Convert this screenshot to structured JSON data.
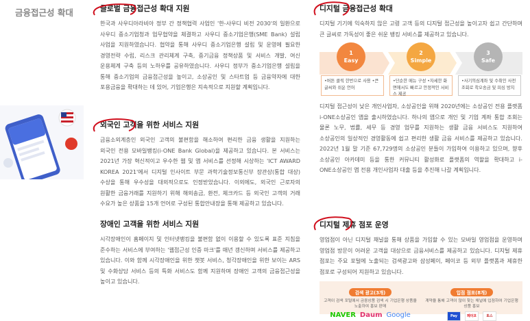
{
  "side_label": "금융접근성 확대",
  "middle": {
    "global": {
      "title": "글로벌 금융접근성 확대 지원",
      "body": "한국과 사우디아라비아 정부 간 정책협력 사업인 '한-사우디 비전 2030'의 일환으로 사우디 중소기업청과 업무협약을 체결하고 사우디 중소기업은행(SME Bank) 설립 사업을 지원하였습니다. 협약을 통해 사우디 중소기업은행 설립 및 운영에 필요한 경영전략 수립, 리스크 관리체계 구축, 중기금융 정책상품 및 서비스 개발, 여신 운용체계 구축 등의 노하우를 공유하였습니다. 사우디 정부가 중소기업은행 설립을 통해 중소기업의 금융접근성을 높이고, 소상공인 및 스타트업 등 금융약자에 대한 포용금융을 확대하는 데 있어, 기업은행은 지속적으로 지원할 계획입니다."
    },
    "foreign": {
      "title": "외국인 고객을 위한 서비스 지원",
      "body": "금융소외계층인 외국인 고객의 불편함을 해소하여 편리한 금융 생활을 지원하는 외국인 전용 모바일뱅킹(i-ONE Bank Global)을 제공하고 있습니다. 본 서비스는 2021년 가장 혁신적이고 우수한 웹 및 앱 서비스를 선정해 시상하는 'ICT AWARD KOREA 2021'에서 디지털 인사이트 부문 과학기술정보통신부 장관상(통합 대상) 수상을 통해 우수성을 대외적으로도 인정받았습니다. 이외에도, 외국인 근로자의 원활한 금융거래를 지원하기 위해 해외송금, 환전, 체크카드 등 외국인 고객의 거래 수요가 높은 상품을 15개 언어로 구성된 통합안내장을 통해 제공하고 있습니다."
    },
    "disabled": {
      "title": "장애인 고객을 위한 서비스 지원",
      "body": "시각장애인이 홈페이지 및 인터넷뱅킹을 불편함 없이 이용할 수 있도록 표준 지침을 준수하는 서비스에 부여하는 '웹접근성 인증 마크'를 매년 갱신하며 서비스를 제공하고 있습니다. 이와 함께 시각장애인을 위한 챗봇 서비스, 청각장애인을 위한 보이는 ARS 및 수화상담 서비스 등의 특화 서비스도 함께 지원하며 장애인 고객의 금융접근성을 높이고 있습니다."
    }
  },
  "right": {
    "digital": {
      "title": "디지털 금융접근성 확대",
      "intro": "디지털 기기에 익숙하지 않은 고령 고객 등의 디지털 접근성을 높이고자 쉽고 간단하며 큰 글씨로 가독성이 좋은 쉬운 뱅킹 서비스를 제공하고 있습니다.",
      "steps": [
        {
          "num": "1",
          "name": "Easy",
          "color": "#f2873f",
          "text": "•버튼 클릭 한번으로 사용 •큰 글씨와 쉬운 언어"
        },
        {
          "num": "2",
          "name": "Simple",
          "color": "#f4a742",
          "text": "•단순한 메뉴 구성 •자세한 화면에서도 빠르고 안정적인 서비스 제공"
        },
        {
          "num": "3",
          "name": "Safe",
          "color": "#b5b5b5",
          "text": "•사기의심계좌 및 수취인 사전 조회로 착오송금 및 피싱 방지"
        }
      ],
      "body": "디지털 접근성이 낮은 개인사업자, 소상공인을 위해 2020년에는 소상공인 전용 플랫폼 i-ONE소상공인 앱을 출시하였습니다. 하나의 앱으로 개인 및 기업 계좌 통합 조회는 물론 노무, 법률, 세무 등 경영 업무를 지원하는 생활 금융 서비스도 지원하여 소상공인의 일상적인 경영활동에 쉽고 편리한 생활 금융 서비스를 제공하고 있습니다. 2022년 1월 말 기준 67,729명의 소상공인 분들이 가입하여 이용하고 있으며, 향후 소상공인 아카데미 등을 통한 커뮤니티 활성화로 플랫폼의 역할을 확대하고 i-ONE소상공인 앱 전용 개인사업자 대출 등을 추진해 나갈 계획입니다."
    },
    "partner": {
      "title": "디지털 제휴 점포 운영",
      "body": "영업점이 아닌 디지털 채널을 통해 상품을 가입할 수 있는 모바일 영업점을 운영하며 영업점 방문이 어려운 고객을 대상으로 금융서비스를 제공하고 있습니다. 디지털 제휴 점포는 주요 포털에 노출되는 검색광고와 삼성페이, 페이코 등 외부 플랫폼과 제휴한 점포로 구성되어 지원하고 있습니다.",
      "search_ad": {
        "label": "검색 광고(3개)",
        "desc": "고객이 검색 포털에서 금융상품 검색 시 기업은행 상품을 노출하여 홍보 판매",
        "logos": [
          "NAVER",
          "Daum",
          "Google"
        ]
      },
      "store": {
        "label": "입점 점포(8개)",
        "desc": "계약을 통해 고객이 많이 찾는 채널에 입점하여 기업은행 상품 홍보",
        "logos": [
          "Pay",
          "페이코",
          "토스"
        ]
      }
    }
  },
  "colors": {
    "accent": "#f07c32",
    "marker": "#d0101e"
  }
}
